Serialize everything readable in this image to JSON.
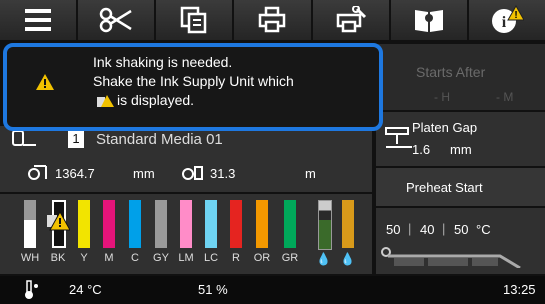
{
  "toolbar": {
    "items": [
      {
        "name": "menu-icon"
      },
      {
        "name": "cutter-icon"
      },
      {
        "name": "copy-icon"
      },
      {
        "name": "print-icon"
      },
      {
        "name": "maintenance-icon"
      },
      {
        "name": "manual-icon"
      },
      {
        "name": "info-alert-icon"
      }
    ]
  },
  "popup": {
    "line1": "Ink shaking is needed.",
    "line2": "Shake the Ink Supply Unit which",
    "line3": "is displayed."
  },
  "starts_after": {
    "label": "Starts After",
    "h": "- H",
    "m": "- M"
  },
  "media": {
    "number": "1",
    "name": "Standard Media 01",
    "length_value": "1364.7",
    "length_unit": "mm",
    "thickness_value": "31.3",
    "thickness_unit": "m"
  },
  "platen_gap": {
    "label": "Platen Gap",
    "value": "1.6",
    "unit": "mm"
  },
  "preheat": {
    "label": "Preheat Start"
  },
  "heater": {
    "t1": "50",
    "t2": "40",
    "t3": "50",
    "unit": "°C"
  },
  "inks": {
    "labels": [
      "WH",
      "BK",
      "Y",
      "M",
      "C",
      "GY",
      "LM",
      "LC",
      "R",
      "OR",
      "GR"
    ],
    "colors": {
      "WH": "#ffffff",
      "BK": "#111111",
      "Y": "#f2e400",
      "M": "#e5147a",
      "C": "#00a0e9",
      "GY": "#9a9a9a",
      "LM": "#ff8cc8",
      "LC": "#6fd3f2",
      "R": "#e52420",
      "OR": "#f39800",
      "GR": "#00a85a"
    }
  },
  "status": {
    "temperature": "24 °C",
    "humidity": "51 %",
    "time": "13:25"
  }
}
